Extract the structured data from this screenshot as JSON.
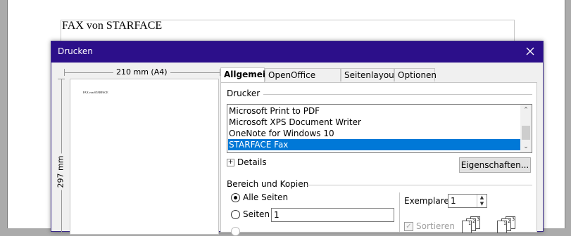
{
  "background": {
    "doc_text": "FAX von STARFACE"
  },
  "dialog": {
    "title": "Drucken",
    "preview": {
      "width_label": "210 mm (A4)",
      "height_label": "297 mm",
      "mini_text": "FAX von STARFACE"
    },
    "tabs": [
      "Allgemein",
      "OpenOffice Writer",
      "Seitenlayout",
      "Optionen"
    ],
    "printer_section": {
      "label": "Drucker",
      "printers": [
        "Microsoft Print to PDF",
        "Microsoft XPS Document Writer",
        "OneNote for Windows 10",
        "STARFACE Fax"
      ],
      "selected": "STARFACE Fax",
      "details_label": "Details",
      "properties_button": "Eigenschaften..."
    },
    "range_section": {
      "label": "Bereich und Kopien",
      "all_pages_label": "Alle Seiten",
      "pages_label": "Seiten",
      "pages_value": "1",
      "copies_label": "Exemplare",
      "copies_value": "1",
      "collate_label": "Sortieren"
    }
  }
}
